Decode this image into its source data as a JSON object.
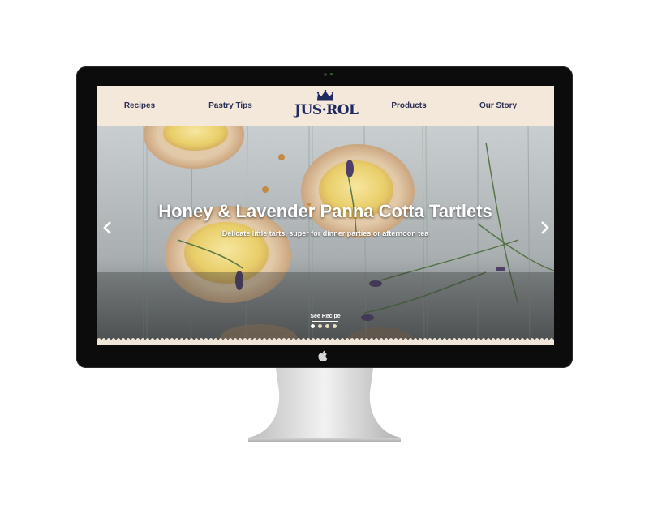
{
  "nav": {
    "items": [
      {
        "label": "Recipes"
      },
      {
        "label": "Pastry Tips"
      },
      {
        "label": "Products"
      },
      {
        "label": "Our Story"
      }
    ],
    "logo_text": "JUS·ROL"
  },
  "hero": {
    "title": "Honey & Lavender Panna Cotta Tartlets",
    "subtitle": "Delicate little tarts, super for dinner parties or afternoon tea",
    "cta_label": "See Recipe",
    "prev_icon": "‹",
    "next_icon": "›",
    "slides_total": 4,
    "active_slide": 1
  },
  "colors": {
    "nav_text": "#2b2e55",
    "nav_bg": "#f3e8da",
    "logo_blue": "#1f2a62",
    "hero_text": "#ffffff"
  },
  "icons": {
    "apple": "apple-logo-icon",
    "crown": "crown-icon",
    "prev": "chevron-left-icon",
    "next": "chevron-right-icon"
  }
}
